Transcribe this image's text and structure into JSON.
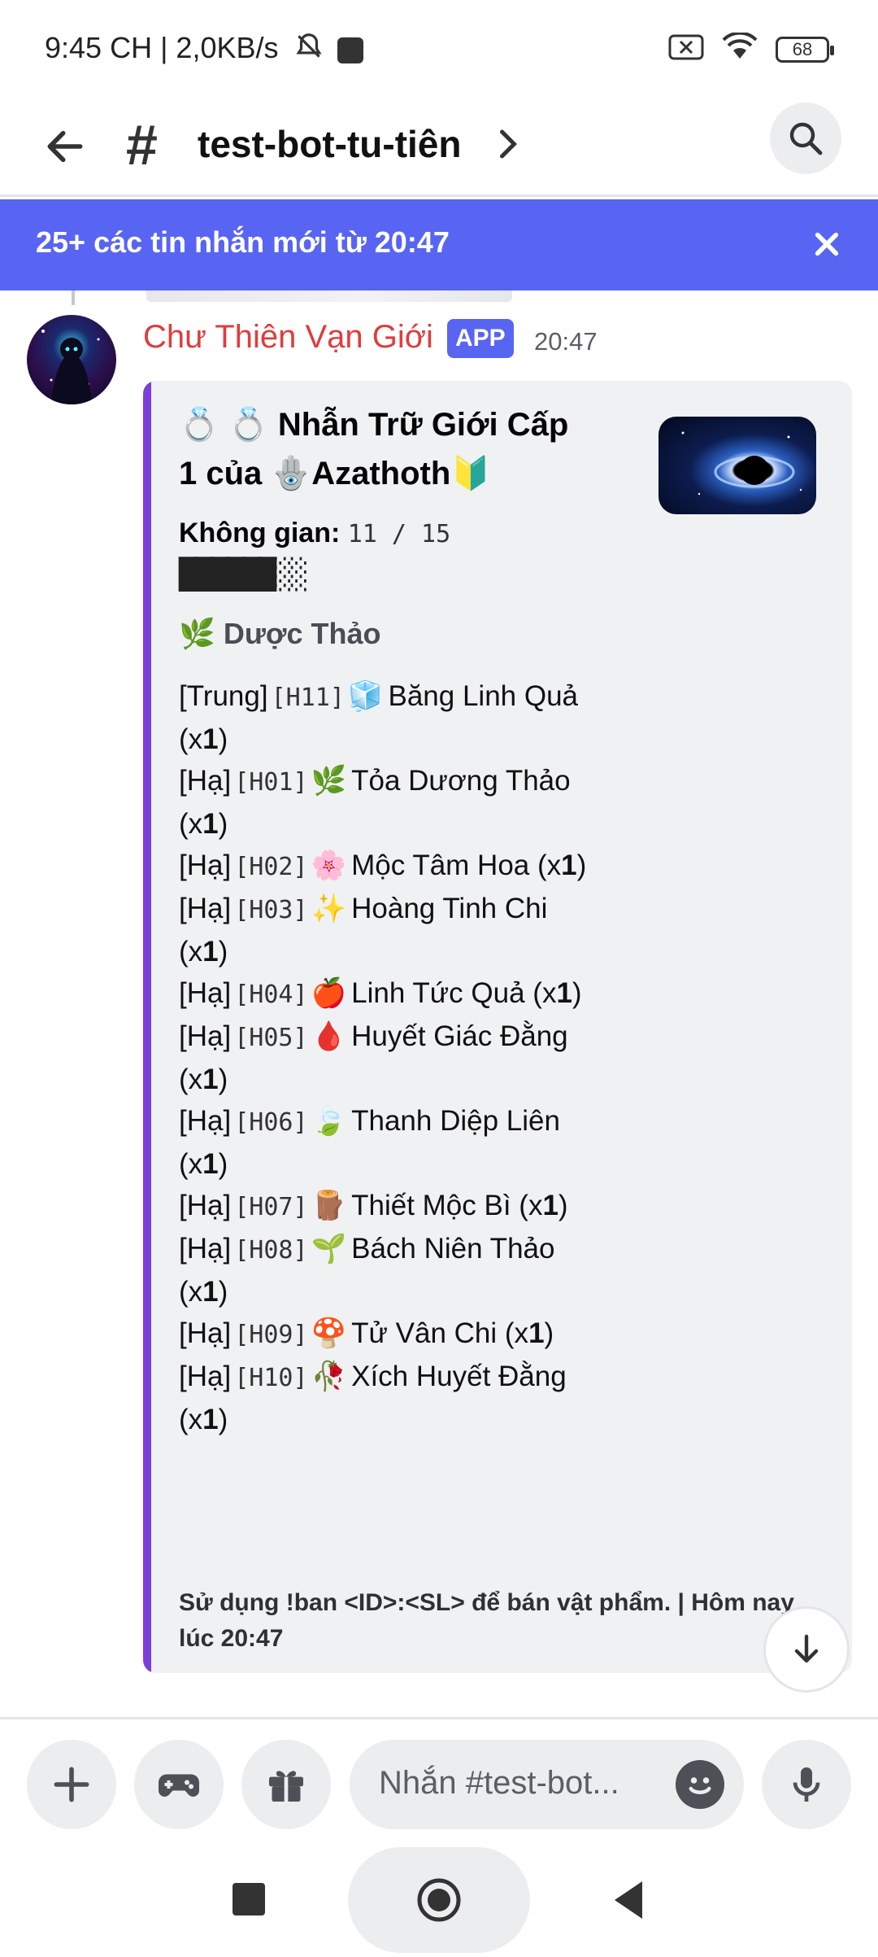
{
  "status_bar": {
    "time": "9:45 CH | 2,0KB/s",
    "battery": "68"
  },
  "header": {
    "channel_name": "test-bot-tu-tiên"
  },
  "banner": {
    "text": "25+ các tin nhắn mới từ 20:47"
  },
  "message": {
    "author": "Chư Thiên Vạn Giới",
    "badge": "APP",
    "time": "20:47"
  },
  "embed": {
    "title_line1": "💍 💍 Nhẫn Trữ Giới Cấp",
    "title_line2": "1 của 🪬Azathoth🔰",
    "space_label": "Không gian:",
    "space_value": "11 / 15",
    "space_bar": "██████░░",
    "section_title": "🌿 Dược Thảo",
    "items": [
      {
        "tier": "[Trung]",
        "code": "[H11]",
        "emoji": "🧊",
        "name": "Băng Linh Quả",
        "qty": "1"
      },
      {
        "tier": "[Hạ]",
        "code": "[H01]",
        "emoji": "🌿",
        "name": "Tỏa Dương Thảo",
        "qty": "1"
      },
      {
        "tier": "[Hạ]",
        "code": "[H02]",
        "emoji": "🌸",
        "name": "Mộc Tâm Hoa",
        "qty": "1"
      },
      {
        "tier": "[Hạ]",
        "code": "[H03]",
        "emoji": "✨",
        "name": "Hoàng Tinh Chi",
        "qty": "1"
      },
      {
        "tier": "[Hạ]",
        "code": "[H04]",
        "emoji": "🍎",
        "name": "Linh Tức Quả",
        "qty": "1"
      },
      {
        "tier": "[Hạ]",
        "code": "[H05]",
        "emoji": "🩸",
        "name": "Huyết Giác Đằng",
        "qty": "1"
      },
      {
        "tier": "[Hạ]",
        "code": "[H06]",
        "emoji": "🍃",
        "name": "Thanh Diệp Liên",
        "qty": "1"
      },
      {
        "tier": "[Hạ]",
        "code": "[H07]",
        "emoji": "🪵",
        "name": "Thiết Mộc Bì",
        "qty": "1"
      },
      {
        "tier": "[Hạ]",
        "code": "[H08]",
        "emoji": "🌱",
        "name": "Bách Niên Thảo",
        "qty": "1"
      },
      {
        "tier": "[Hạ]",
        "code": "[H09]",
        "emoji": "🍄",
        "name": "Tử Vân Chi",
        "qty": "1"
      },
      {
        "tier": "[Hạ]",
        "code": "[H10]",
        "emoji": "🥀",
        "name": "Xích Huyết Đằng",
        "qty": "1"
      }
    ],
    "footer": "Sử dụng !ban <ID>:<SL> để bán vật phẩm. | Hôm nay lúc 20:47"
  },
  "composer": {
    "placeholder": "Nhắn #test-bot..."
  },
  "icons": {
    "back": "arrow-left-icon",
    "search": "search-icon",
    "close": "close-icon",
    "plus": "plus-icon",
    "game": "gamepad-icon",
    "gift": "gift-icon",
    "emoji": "emoji-icon",
    "mic": "microphone-icon",
    "scroll_down": "arrow-down-icon"
  },
  "colors": {
    "brand": "#5865f2",
    "embed_accent": "#7c3ed8",
    "author": "#e03c3c"
  }
}
